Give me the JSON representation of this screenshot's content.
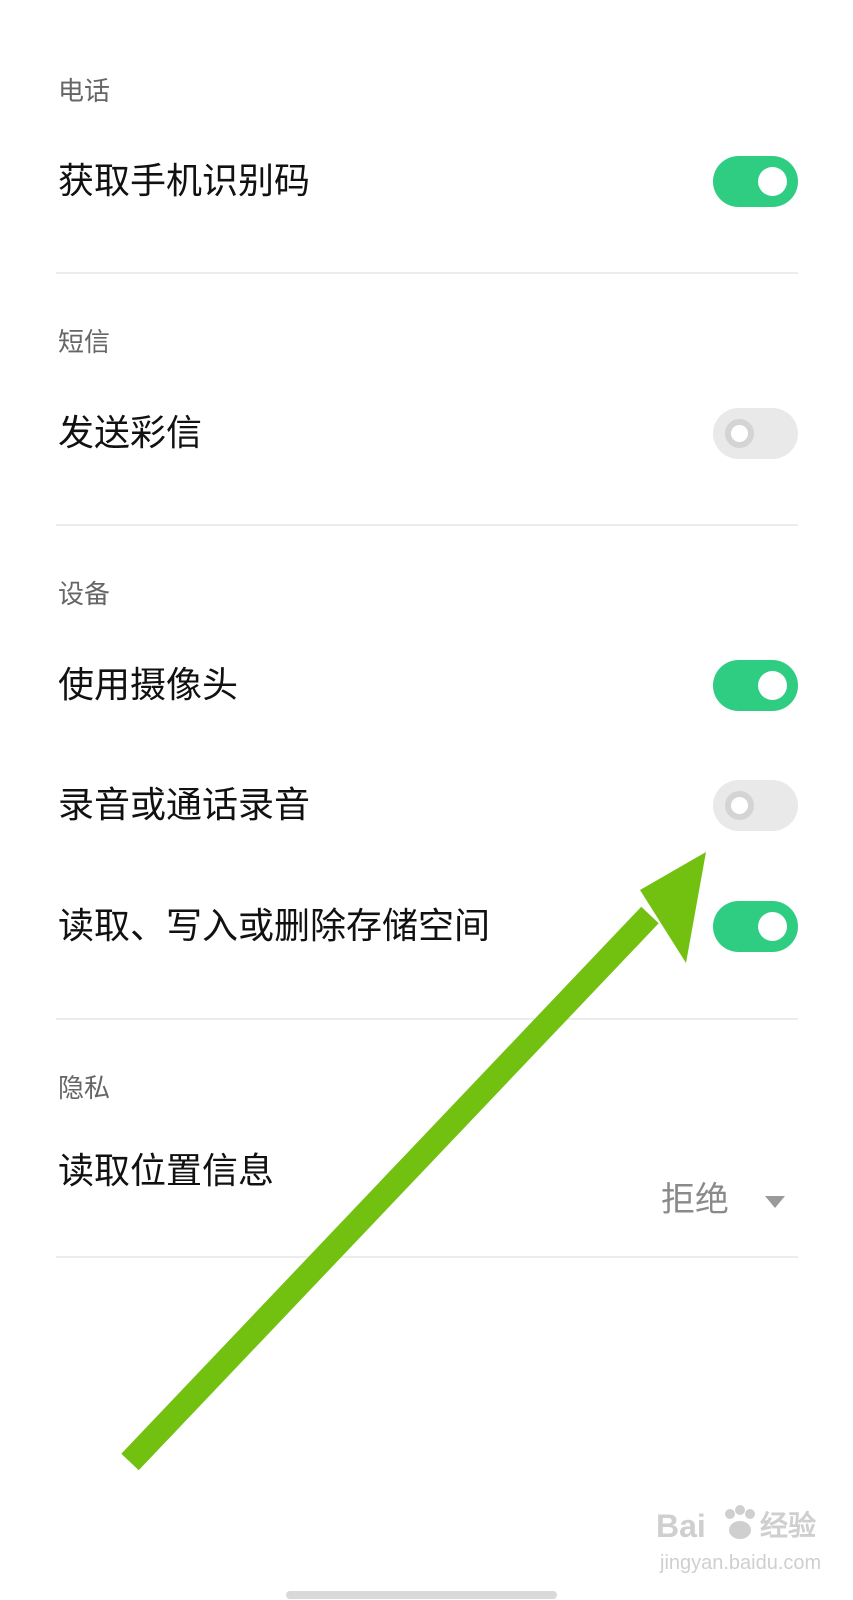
{
  "sections": [
    {
      "title": "电话",
      "items": [
        {
          "label": "获取手机识别码",
          "enabled": true
        }
      ]
    },
    {
      "title": "短信",
      "items": [
        {
          "label": "发送彩信",
          "enabled": false
        }
      ]
    },
    {
      "title": "设备",
      "items": [
        {
          "label": "使用摄像头",
          "enabled": true
        },
        {
          "label": "录音或通话录音",
          "enabled": false
        },
        {
          "label": "读取、写入或删除存储空间",
          "enabled": true
        }
      ]
    },
    {
      "title": "隐私",
      "items": [
        {
          "label": "读取位置信息",
          "value": "拒绝"
        }
      ]
    }
  ],
  "colors": {
    "toggle_on": "#2fcd82",
    "toggle_off": "#e9e9e9",
    "annotation_arrow": "#72c111"
  },
  "icons": {
    "annotation": "green-arrow-icon",
    "dropdown": "triangle-down-icon"
  },
  "watermark": {
    "brand": "Bai",
    "brand_cn": "经验",
    "url": "jingyan.baidu.com"
  }
}
